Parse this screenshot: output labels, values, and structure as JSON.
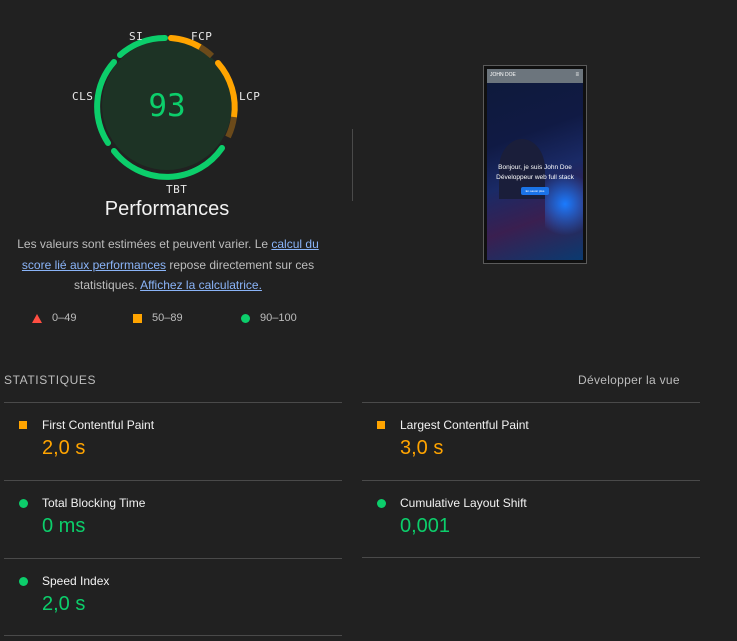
{
  "gauge": {
    "score": "93",
    "labels": {
      "si": "SI",
      "fcp": "FCP",
      "lcp": "LCP",
      "tbt": "TBT",
      "cls": "CLS"
    },
    "title": "Performances",
    "colors": {
      "good": "#0cce6b",
      "average": "#ffa400",
      "track": "#2a3a2e"
    }
  },
  "description": {
    "part1": "Les valeurs sont estimées et peuvent varier. Le ",
    "link1": "calcul du score lié aux performances",
    "part2": " repose directement sur ces statistiques. ",
    "link2": "Affichez la calculatrice."
  },
  "legend": [
    {
      "icon": "triangle-icon",
      "range": "0–49"
    },
    {
      "icon": "square-icon",
      "range": "50–89"
    },
    {
      "icon": "circle-icon",
      "range": "90–100"
    }
  ],
  "screenshot": {
    "brand": "JOHN DOE",
    "menu": "≡",
    "hero_line1": "Bonjour, je suis John Doe",
    "hero_line2": "Développeur web full stack",
    "button": "En savoir plus"
  },
  "stats": {
    "header": "STATISTIQUES",
    "expand": "Développer la vue",
    "metrics": [
      {
        "name": "First Contentful Paint",
        "value": "2,0 s",
        "rating": "average"
      },
      {
        "name": "Largest Contentful Paint",
        "value": "3,0 s",
        "rating": "average"
      },
      {
        "name": "Total Blocking Time",
        "value": "0 ms",
        "rating": "good"
      },
      {
        "name": "Cumulative Layout Shift",
        "value": "0,001",
        "rating": "good"
      },
      {
        "name": "Speed Index",
        "value": "2,0 s",
        "rating": "good"
      }
    ]
  }
}
